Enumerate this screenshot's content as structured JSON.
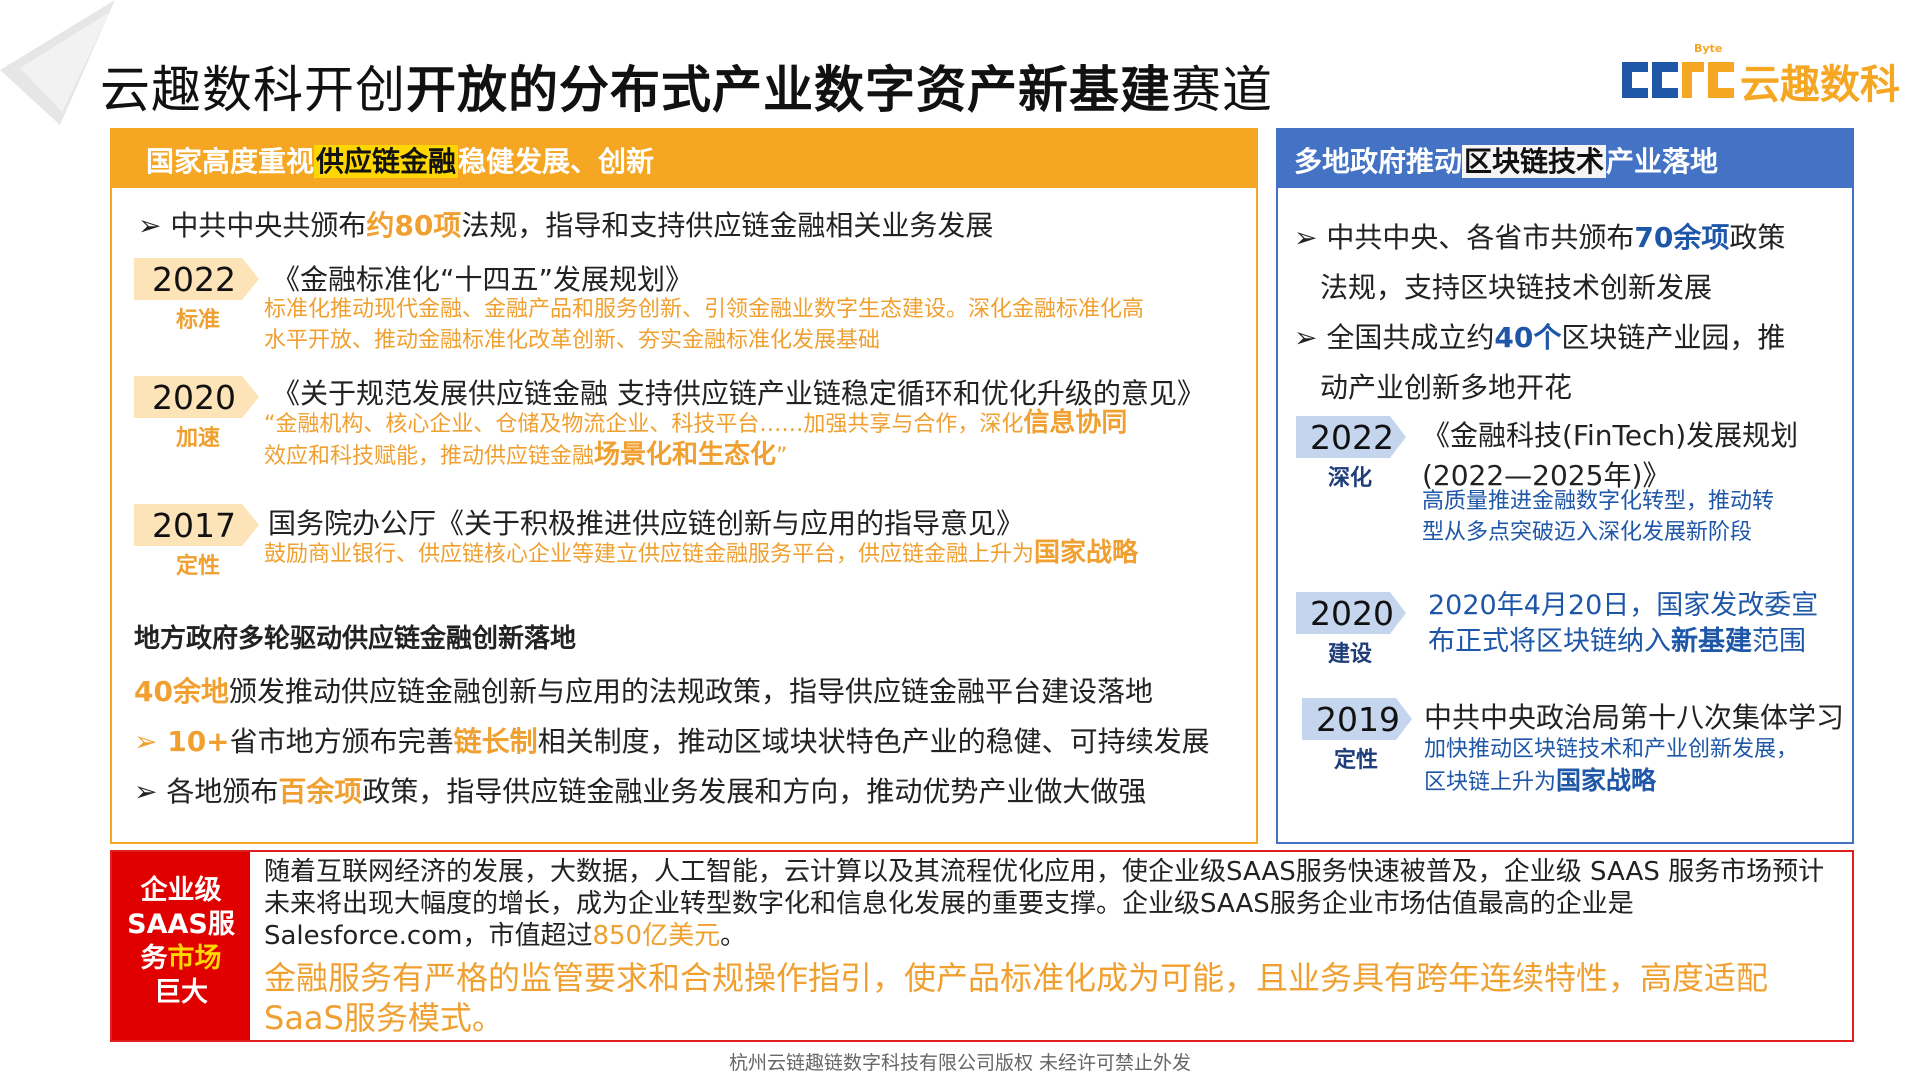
{
  "header": {
    "title_plain": "云趣数科开创",
    "title_bold": "开放的分布式产业数字资产新基建",
    "title_end": "赛道",
    "logo_sup": "Byte",
    "logo_text": "云趣数科"
  },
  "left": {
    "head_pre": "国家高度重视",
    "head_hl": "供应链金融",
    "head_post": "稳健发展、创新",
    "intro_pre": "➢ 中共中央共颁布",
    "intro_hl": "约80项",
    "intro_post": "法规，指导和支持供应链金融相关业务发展",
    "items": [
      {
        "year": "2022",
        "tag": "标准",
        "title": "《金融标准化“十四五”发展规划》",
        "desc1": "标准化推动现代金融、金融产品和服务创新、引领金融业数字生态建设。深化金融标准化高",
        "desc2": "水平开放、推动金融标准化改革创新、夯实金融标准化发展基础"
      },
      {
        "year": "2020",
        "tag": "加速",
        "title": "《关于规范发展供应链金融 支持供应链产业链稳定循环和优化升级的意见》",
        "desc1_pre": "“金融机构、核心企业、仓储及物流企业、科技平台……加强共享与合作，深化",
        "desc1_hl": "信息协同",
        "desc2_pre": "效应和科技赋能，推动供应链金融",
        "desc2_hl": "场景化和生态化",
        "desc2_post": "”"
      },
      {
        "year": "2017",
        "tag": "定性",
        "title": "国务院办公厅《关于积极推进供应链创新与应用的指导意见》",
        "desc1_pre": "鼓励商业银行、供应链核心企业等建立供应链金融服务平台，供应链金融上升为",
        "desc1_hl": "国家战略"
      }
    ],
    "local_heading": "地方政府多轮驱动供应链金融创新落地",
    "local1_hl": "40余地",
    "local1_post": "颁发推动供应链金融创新与应用的法规政策，指导供应链金融平台建设落地",
    "local2_pre": "➢ 10+",
    "local2_mid": "省市地方颁布完善",
    "local2_hl": "链长制",
    "local2_post": "相关制度，推动区域块状特色产业的稳健、可持续发展",
    "local3_pre": "➢ 各地颁布",
    "local3_hl": "百余项",
    "local3_post": "政策，指导供应链金融业务发展和方向，推动优势产业做大做强"
  },
  "right": {
    "head_pre": "多地政府推动",
    "head_hl": "区块链技术",
    "head_post": "产业落地",
    "p1_pre": "➢ 中共中央、各省市共颁布",
    "p1_hl": "70余项",
    "p1_post": "政策",
    "p1_line2": "法规，支持区块链技术创新发展",
    "p2_pre": "➢ 全国共成立约",
    "p2_hl": "40个",
    "p2_post": "区块链产业园，推",
    "p2_line2": "动产业创新多地开花",
    "items": [
      {
        "year": "2022",
        "tag": "深化",
        "title1": "《金融科技(FinTech)发展规划",
        "title2": "(2022—2025年)》",
        "desc1": "高质量推进金融数字化转型，推动转",
        "desc2": "型从多点突破迈入深化发展新阶段"
      },
      {
        "year": "2020",
        "tag": "建设",
        "line1": "2020年4月20日，国家发改委宣",
        "line2_pre": "布正式将区块链纳入",
        "line2_hl": "新基建",
        "line2_post": "范围"
      },
      {
        "year": "2019",
        "tag": "定性",
        "title": "中共中央政治局第十八次集体学习",
        "desc1": "加快推动区块链技术和产业创新发展，",
        "desc2_pre": "区块链上升为",
        "desc2_hl": "国家战略"
      }
    ]
  },
  "bottom": {
    "label_l1": "企业级",
    "label_l2": "SAAS服",
    "label_l3a": "务",
    "label_l3b": "市场",
    "label_l4": "巨大",
    "p1": "随着互联网经济的发展，大数据，人工智能，云计算以及其流程优化应用，使企业级SAAS服务快速被普及，企业级 SAAS 服务市场预计未来将出现大幅度的增长，成为企业转型数字化和信息化发展的重要支撑。企业级SAAS服务企业市场估值最高的企业是Salesforce.com，市值超过",
    "p1_hl": "850亿美元",
    "p1_end": "。",
    "p2": "金融服务有严格的监管要求和合规操作指引，使产品标准化成为可能，且业务具有跨年连续特性，高度适配SaaS服务模式。"
  },
  "footer": "杭州云链趣链数字科技有限公司版权 未经许可禁止外发",
  "colors": {
    "orange": "#f5a623",
    "blue": "#4472c4",
    "red": "#e00000",
    "highlight": "#ffd700"
  }
}
